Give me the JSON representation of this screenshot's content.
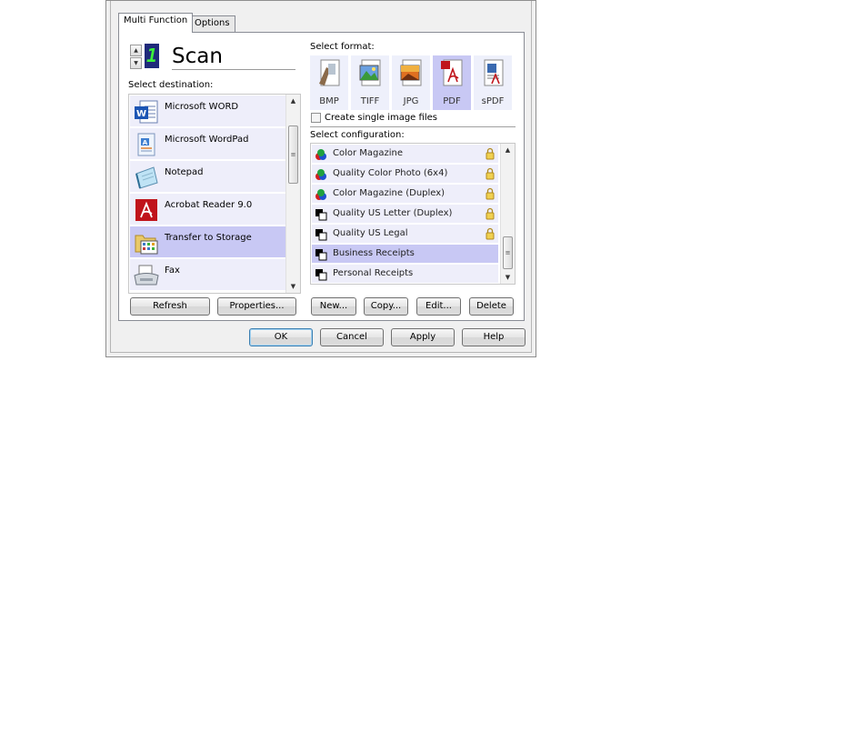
{
  "tabs": [
    {
      "label": "Multi Function",
      "active": true
    },
    {
      "label": "Options",
      "active": false
    }
  ],
  "scan": {
    "number": "1",
    "title": "Scan"
  },
  "destination": {
    "label": "Select destination:",
    "items": [
      {
        "label": "Microsoft WORD",
        "icon": "word-icon"
      },
      {
        "label": "Microsoft WordPad",
        "icon": "wordpad-icon"
      },
      {
        "label": "Notepad",
        "icon": "notepad-icon"
      },
      {
        "label": "Acrobat Reader 9.0",
        "icon": "acrobat-icon"
      },
      {
        "label": "Transfer to Storage",
        "icon": "folder-icon",
        "selected": true
      },
      {
        "label": "Fax",
        "icon": "fax-icon"
      }
    ],
    "refresh_label": "Refresh",
    "properties_label": "Properties..."
  },
  "format": {
    "label": "Select format:",
    "items": [
      {
        "label": "BMP",
        "icon": "bmp-icon"
      },
      {
        "label": "TIFF",
        "icon": "tiff-icon"
      },
      {
        "label": "JPG",
        "icon": "jpg-icon"
      },
      {
        "label": "PDF",
        "icon": "pdf-icon",
        "selected": true
      },
      {
        "label": "sPDF",
        "icon": "spdf-icon"
      }
    ],
    "single_image_label": "Create single image files",
    "single_image_checked": false
  },
  "configuration": {
    "label": "Select configuration:",
    "items": [
      {
        "label": "Color Magazine",
        "icon": "color-config-icon",
        "locked": true
      },
      {
        "label": "Quality Color Photo (6x4)",
        "icon": "color-config-icon",
        "locked": true
      },
      {
        "label": "Color Magazine (Duplex)",
        "icon": "color-config-icon",
        "locked": true
      },
      {
        "label": "Quality US Letter (Duplex)",
        "icon": "bw-config-icon",
        "locked": true
      },
      {
        "label": "Quality US Legal",
        "icon": "bw-config-icon",
        "locked": true
      },
      {
        "label": "Business Receipts",
        "icon": "bw-config-icon",
        "locked": false,
        "selected": true
      },
      {
        "label": "Personal Receipts",
        "icon": "bw-config-icon",
        "locked": false
      }
    ],
    "new_label": "New...",
    "copy_label": "Copy...",
    "edit_label": "Edit...",
    "delete_label": "Delete"
  },
  "footer": {
    "ok_label": "OK",
    "cancel_label": "Cancel",
    "apply_label": "Apply",
    "help_label": "Help"
  },
  "colors": {
    "selection": "#c8c8f4",
    "item_bg": "#eeeefa",
    "digit_bg": "#1f2a7a",
    "digit_fg": "#3cf03c"
  }
}
